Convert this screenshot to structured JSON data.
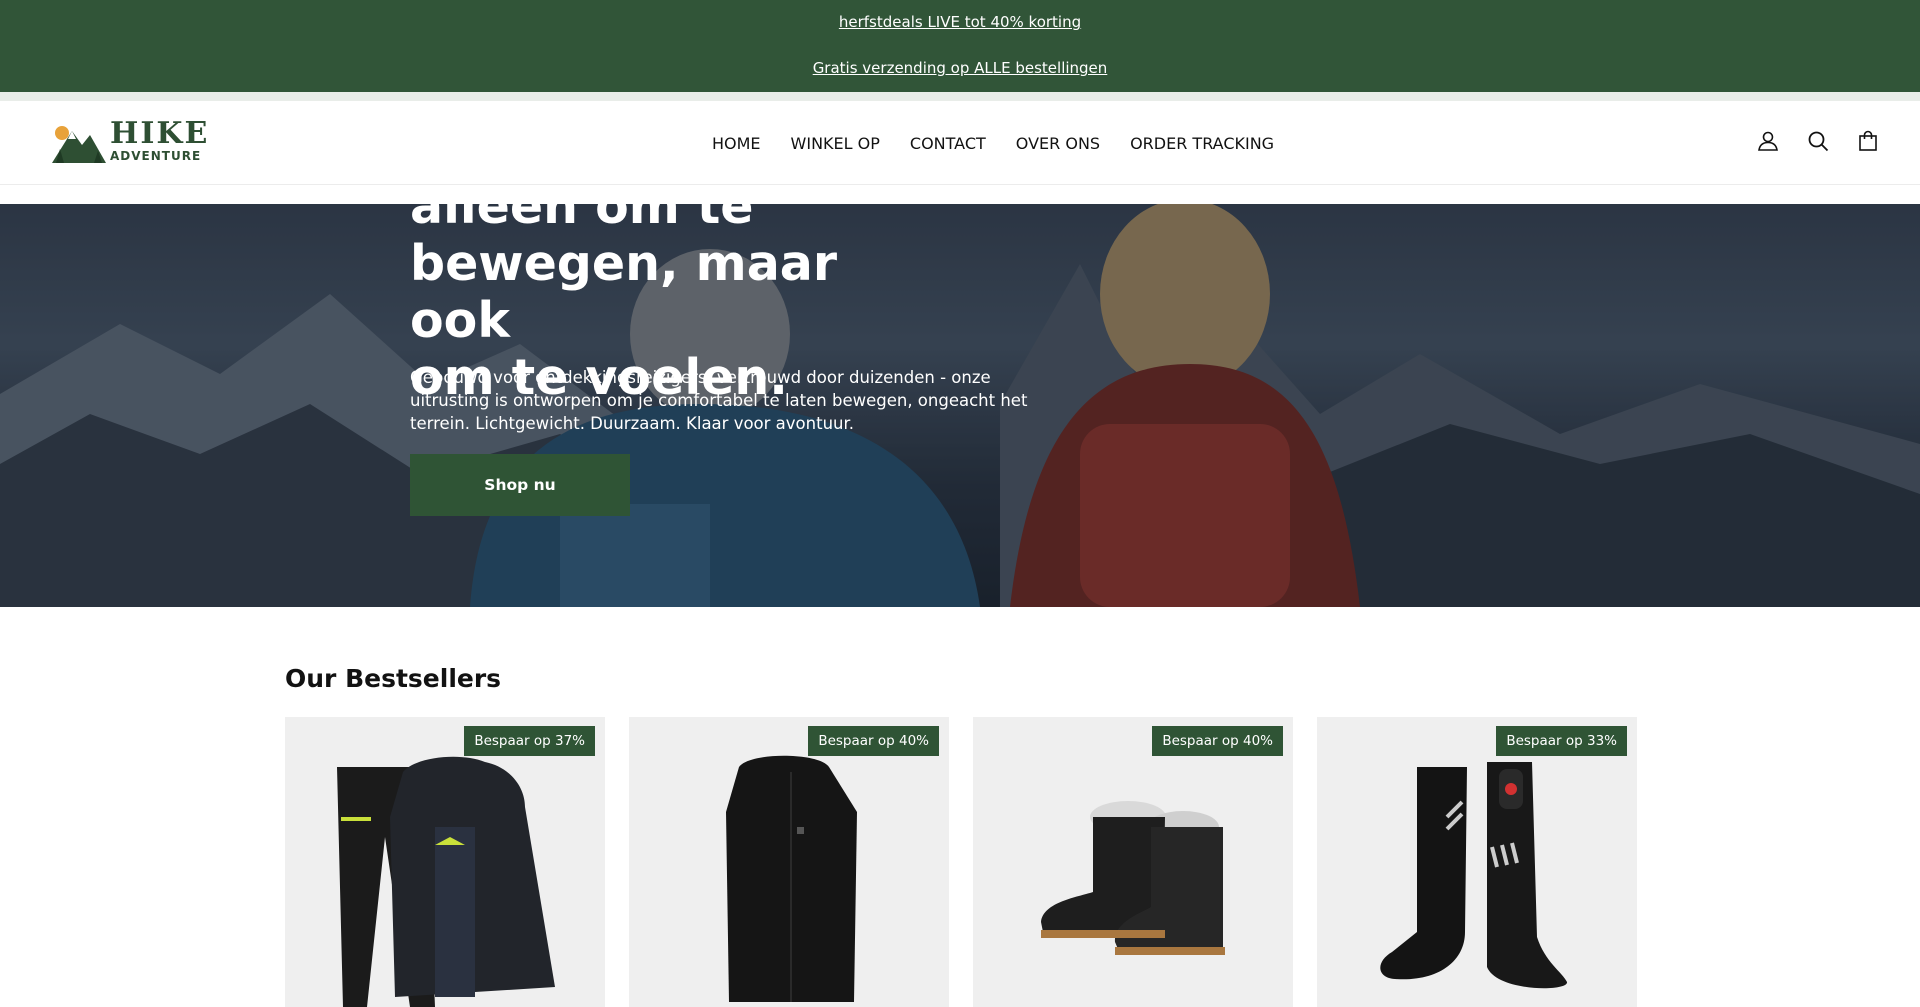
{
  "announcement": {
    "line1": "herfstdeals LIVE tot 40% korting",
    "line2": "Gratis verzending op ALLE bestellingen"
  },
  "brand": {
    "name_line1": "HIKE",
    "name_line2": "ADVENTURE",
    "primary_color": "#315538"
  },
  "nav": {
    "items": [
      "HOME",
      "WINKEL OP",
      "CONTACT",
      "OVER ONS",
      "ORDER TRACKING"
    ]
  },
  "header_icons": [
    "account-icon",
    "search-icon",
    "cart-icon"
  ],
  "hero": {
    "title_lines": [
      "alleen om te",
      "bewegen, maar ook",
      "om te voelen."
    ],
    "subtitle": "Gebouwd voor ontdekkingsreizigers, vertrouwd door duizenden - onze uitrusting is ontworpen om je comfortabel te laten bewegen, ongeacht het terrein. Lichtgewicht. Duurzaam. Klaar voor avontuur.",
    "button": "Shop nu"
  },
  "bestsellers": {
    "title": "Our Bestsellers",
    "products": [
      {
        "badge": "Bespaar op 37%",
        "image": "ski-suit"
      },
      {
        "badge": "Bespaar op 40%",
        "image": "heated-vest"
      },
      {
        "badge": "Bespaar op 40%",
        "image": "snow-boots"
      },
      {
        "badge": "Bespaar op 33%",
        "image": "heated-socks"
      }
    ]
  }
}
